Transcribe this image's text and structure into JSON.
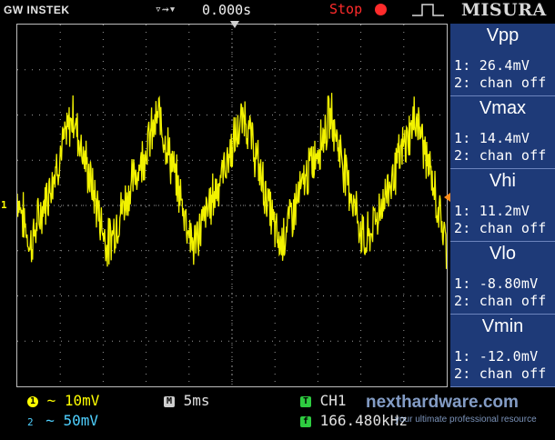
{
  "header": {
    "brand": "GW INSTEK",
    "trigger_icon": "trigger-delay-icon",
    "trigger_time": "0.000s",
    "run_status": "Stop",
    "edge_icon": "rising-edge-icon",
    "watermark": "MISURA"
  },
  "screen": {
    "channel_marker": "1",
    "trace_color": "#ffff00",
    "grid_color": "#9a9a9a",
    "waveform": {
      "peaks_time_div": [
        1.3,
        3.3,
        5.3,
        7.3,
        9.3
      ],
      "troughs_time_div": [
        0.3,
        2.1,
        4.1,
        6.1,
        8.1
      ],
      "peak_level_div": 2.0,
      "trough_level_div": -0.9
    }
  },
  "measurements": [
    {
      "name": "Vpp",
      "ch1": "1: 26.4mV",
      "ch2": "2: chan off"
    },
    {
      "name": "Vmax",
      "ch1": "1: 14.4mV",
      "ch2": "2: chan off"
    },
    {
      "name": "Vhi",
      "ch1": "1: 11.2mV",
      "ch2": "2: chan off"
    },
    {
      "name": "Vlo",
      "ch1": "1: -8.80mV",
      "ch2": "2: chan off"
    },
    {
      "name": "Vmin",
      "ch1": "1: -12.0mV",
      "ch2": "2: chan off"
    }
  ],
  "footer": {
    "ch1_badge": "1",
    "ch1_scale": "~ 10mV",
    "ch2_badge": "2",
    "ch2_scale": "~ 50mV",
    "timebase_badge": "M",
    "timebase": "5ms",
    "trigger_badge": "T",
    "trigger_source": "CH1",
    "freq_badge": "f",
    "frequency": "166.480kHz",
    "watermark_main": "nexthardware.com",
    "watermark_sub": "your ultimate professional resource"
  },
  "colors": {
    "ch1": "#ffff00",
    "ch2": "#4fd0ff",
    "panel": "#1e3a78",
    "stop": "#ff2b2b"
  }
}
